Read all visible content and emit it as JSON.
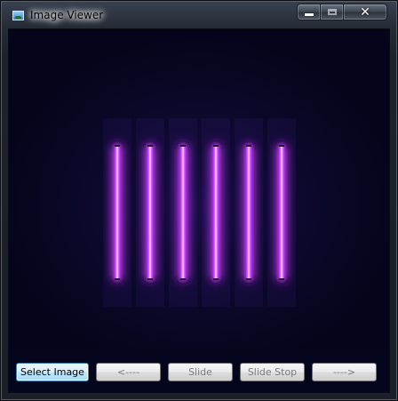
{
  "window": {
    "title": "Image Viewer",
    "icon": "image-viewer-app-icon"
  },
  "caption_buttons": {
    "minimize_icon": "minimize-icon",
    "maximize_icon": "maximize-icon",
    "close_glyph": "✕"
  },
  "viewer": {
    "background_color": "#06051e",
    "neon_color": "#d040ff",
    "neon_tube_count": 6
  },
  "toolbar": {
    "select_image": "Select Image",
    "previous": "<----",
    "slide": "Slide",
    "slide_stop": "Slide Stop",
    "next": "---->"
  }
}
